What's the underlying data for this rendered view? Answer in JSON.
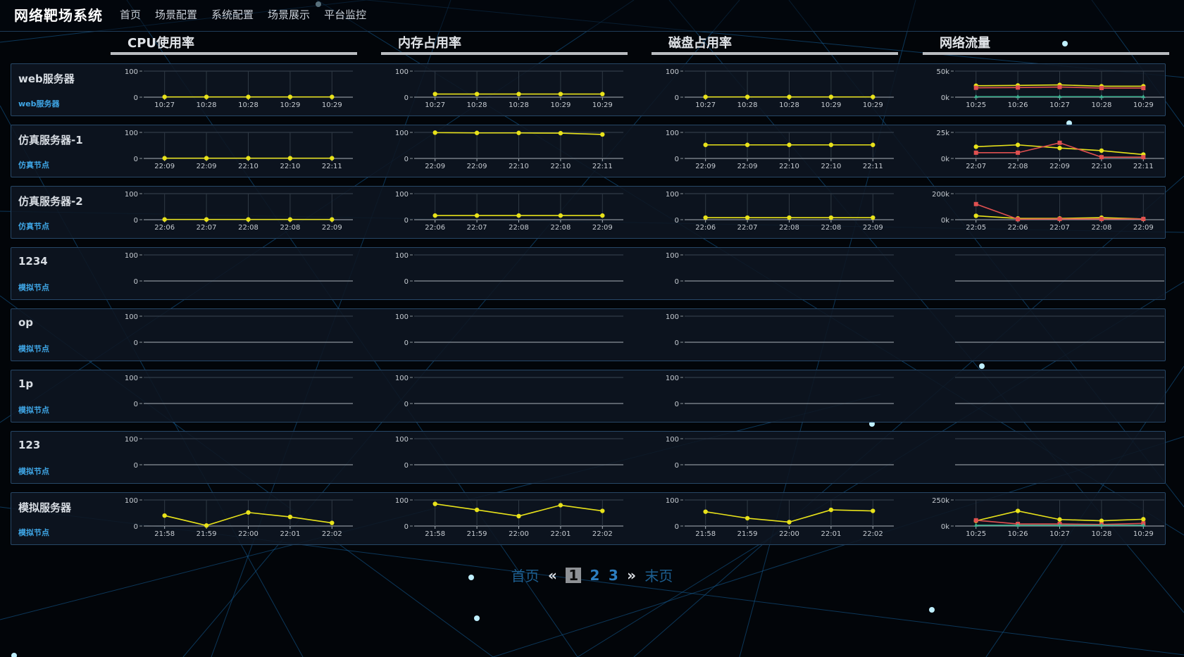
{
  "app": {
    "title": "网络靶场系统",
    "nav": [
      "首页",
      "场景配置",
      "系统配置",
      "场景展示",
      "平台监控"
    ]
  },
  "columns": [
    "CPU使用率",
    "内存占用率",
    "磁盘占用率",
    "网络流量"
  ],
  "colors": {
    "series_a": "#e8e21a",
    "series_b": "#e05050",
    "series_c": "#3bb08f",
    "accent": "#3fa6e6"
  },
  "servers": [
    {
      "name": "web服务器",
      "type": "web服务器",
      "cpu": {
        "ymax": "100",
        "ymin": "0",
        "times": [
          "10:27",
          "10:28",
          "10:28",
          "10:29",
          "10:29"
        ],
        "series": [
          [
            1,
            1,
            1,
            1,
            1
          ]
        ]
      },
      "mem": {
        "ymax": "100",
        "ymin": "0",
        "times": [
          "10:27",
          "10:28",
          "10:28",
          "10:29",
          "10:29"
        ],
        "series": [
          [
            12,
            12,
            12,
            12,
            12
          ]
        ]
      },
      "disk": {
        "ymax": "100",
        "ymin": "0",
        "times": [
          "10:27",
          "10:28",
          "10:28",
          "10:29",
          "10:29"
        ],
        "series": [
          [
            1,
            1,
            1,
            1,
            1
          ]
        ]
      },
      "net": {
        "ymax": "50k",
        "ymin": "0k",
        "times": [
          "10:25",
          "10:26",
          "10:27",
          "10:28",
          "10:29"
        ],
        "series": [
          [
            44,
            45,
            47,
            42,
            42
          ],
          [
            36,
            37,
            39,
            35,
            35
          ],
          [
            2,
            2,
            2,
            2,
            2
          ]
        ]
      }
    },
    {
      "name": "仿真服务器-1",
      "type": "仿真节点",
      "cpu": {
        "ymax": "100",
        "ymin": "0",
        "times": [
          "22:09",
          "22:09",
          "22:10",
          "22:10",
          "22:11"
        ],
        "series": [
          [
            1,
            1,
            1,
            1,
            1
          ]
        ]
      },
      "mem": {
        "ymax": "100",
        "ymin": "0",
        "times": [
          "22:09",
          "22:09",
          "22:10",
          "22:10",
          "22:11"
        ],
        "series": [
          [
            99,
            98,
            98,
            97,
            92
          ]
        ]
      },
      "disk": {
        "ymax": "100",
        "ymin": "0",
        "times": [
          "22:09",
          "22:09",
          "22:10",
          "22:10",
          "22:11"
        ],
        "series": [
          [
            52,
            52,
            52,
            52,
            52
          ]
        ]
      },
      "net": {
        "ymax": "25k",
        "ymin": "0k",
        "times": [
          "22:07",
          "22:08",
          "22:09",
          "22:10",
          "22:11"
        ],
        "series": [
          [
            45,
            52,
            40,
            30,
            15
          ],
          [
            22,
            22,
            60,
            5,
            5
          ]
        ]
      }
    },
    {
      "name": "仿真服务器-2",
      "type": "仿真节点",
      "cpu": {
        "ymax": "100",
        "ymin": "0",
        "times": [
          "22:06",
          "22:07",
          "22:08",
          "22:08",
          "22:09"
        ],
        "series": [
          [
            1,
            1,
            1,
            1,
            1
          ]
        ]
      },
      "mem": {
        "ymax": "100",
        "ymin": "0",
        "times": [
          "22:06",
          "22:07",
          "22:08",
          "22:08",
          "22:09"
        ],
        "series": [
          [
            16,
            16,
            16,
            16,
            16
          ]
        ]
      },
      "disk": {
        "ymax": "100",
        "ymin": "0",
        "times": [
          "22:06",
          "22:07",
          "22:08",
          "22:08",
          "22:09"
        ],
        "series": [
          [
            8,
            8,
            8,
            8,
            8
          ]
        ]
      },
      "net": {
        "ymax": "200k",
        "ymin": "0k",
        "times": [
          "22:05",
          "22:06",
          "22:07",
          "22:08",
          "22:09"
        ],
        "series": [
          [
            15,
            5,
            5,
            8,
            3
          ],
          [
            60,
            2,
            3,
            3,
            3
          ]
        ]
      }
    },
    {
      "name": "1234",
      "type": "模拟节点",
      "cpu": {
        "ymax": "100",
        "ymin": "0",
        "times": [],
        "series": []
      },
      "mem": {
        "ymax": "100",
        "ymin": "0",
        "times": [],
        "series": []
      },
      "disk": {
        "ymax": "100",
        "ymin": "0",
        "times": [],
        "series": []
      },
      "net": {
        "ymax": "",
        "ymin": "",
        "times": [],
        "series": []
      }
    },
    {
      "name": "op",
      "type": "模拟节点",
      "cpu": {
        "ymax": "100",
        "ymin": "0",
        "times": [],
        "series": []
      },
      "mem": {
        "ymax": "100",
        "ymin": "0",
        "times": [],
        "series": []
      },
      "disk": {
        "ymax": "100",
        "ymin": "0",
        "times": [],
        "series": []
      },
      "net": {
        "ymax": "",
        "ymin": "",
        "times": [],
        "series": []
      }
    },
    {
      "name": "1p",
      "type": "模拟节点",
      "cpu": {
        "ymax": "100",
        "ymin": "0",
        "times": [],
        "series": []
      },
      "mem": {
        "ymax": "100",
        "ymin": "0",
        "times": [],
        "series": []
      },
      "disk": {
        "ymax": "100",
        "ymin": "0",
        "times": [],
        "series": []
      },
      "net": {
        "ymax": "",
        "ymin": "",
        "times": [],
        "series": []
      }
    },
    {
      "name": "123",
      "type": "模拟节点",
      "cpu": {
        "ymax": "100",
        "ymin": "0",
        "times": [],
        "series": []
      },
      "mem": {
        "ymax": "100",
        "ymin": "0",
        "times": [],
        "series": []
      },
      "disk": {
        "ymax": "100",
        "ymin": "0",
        "times": [],
        "series": []
      },
      "net": {
        "ymax": "",
        "ymin": "",
        "times": [],
        "series": []
      }
    },
    {
      "name": "模拟服务器",
      "type": "模拟节点",
      "cpu": {
        "ymax": "100",
        "ymin": "0",
        "times": [
          "21:58",
          "21:59",
          "22:00",
          "22:01",
          "22:02"
        ],
        "series": [
          [
            40,
            2,
            52,
            35,
            12
          ]
        ]
      },
      "mem": {
        "ymax": "100",
        "ymin": "0",
        "times": [
          "21:58",
          "21:59",
          "22:00",
          "22:01",
          "22:02"
        ],
        "series": [
          [
            85,
            62,
            38,
            80,
            58
          ]
        ]
      },
      "disk": {
        "ymax": "100",
        "ymin": "0",
        "times": [
          "21:58",
          "21:59",
          "22:00",
          "22:01",
          "22:02"
        ],
        "series": [
          [
            55,
            30,
            15,
            62,
            58
          ]
        ]
      },
      "net": {
        "ymax": "250k",
        "ymin": "0k",
        "times": [
          "10:25",
          "10:26",
          "10:27",
          "10:28",
          "10:29"
        ],
        "series": [
          [
            20,
            58,
            25,
            20,
            26
          ],
          [
            22,
            8,
            8,
            6,
            10
          ],
          [
            3,
            3,
            3,
            3,
            3
          ]
        ]
      }
    }
  ],
  "pagination": {
    "first": "首页",
    "prev": "«",
    "pages": [
      "1",
      "2",
      "3"
    ],
    "current": "1",
    "next": "»",
    "last": "末页"
  }
}
